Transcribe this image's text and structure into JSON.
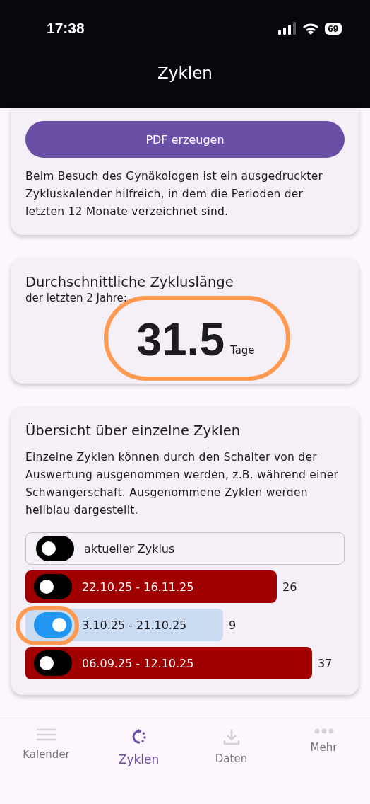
{
  "status_bar": {
    "time": "17:38",
    "battery": "69"
  },
  "header": {
    "title": "Zyklen"
  },
  "pdf_card": {
    "button": "PDF erzeugen",
    "text": "Beim Besuch des Gynäkologen ist ein ausgedruckter Zykluskalender hilfreich, in dem die Perioden der letzten 12 Monate verzeichnet sind."
  },
  "average_card": {
    "title": "Durchschnittliche Zykluslänge",
    "subtitle": "der letzten 2 Jahre:",
    "value": "31.5",
    "unit": "Tage",
    "highlighted": true
  },
  "overview_card": {
    "title": "Übersicht über einzelne Zyklen",
    "text": "Einzelne Zyklen können durch den Schalter von der Auswertung ausgenommen werden, z.B. während einer Schwangerschaft. Ausgenommene Zyklen werden hellblau dargestellt.",
    "current": {
      "label": "aktueller Zyklus",
      "on": false
    },
    "cycles": [
      {
        "range": "22.10.25 - 16.11.25",
        "days": "26",
        "on": false,
        "highlighted": false
      },
      {
        "range": "3.10.25 - 21.10.25",
        "days": "9",
        "on": true,
        "highlighted": true
      },
      {
        "range": "06.09.25 - 12.10.25",
        "days": "37",
        "on": false,
        "highlighted": false
      }
    ]
  },
  "tabs": [
    {
      "label": "Kalender",
      "selected": false
    },
    {
      "label": "Zyklen",
      "selected": true
    },
    {
      "label": "Daten",
      "selected": false
    },
    {
      "label": "Mehr",
      "selected": false
    }
  ]
}
